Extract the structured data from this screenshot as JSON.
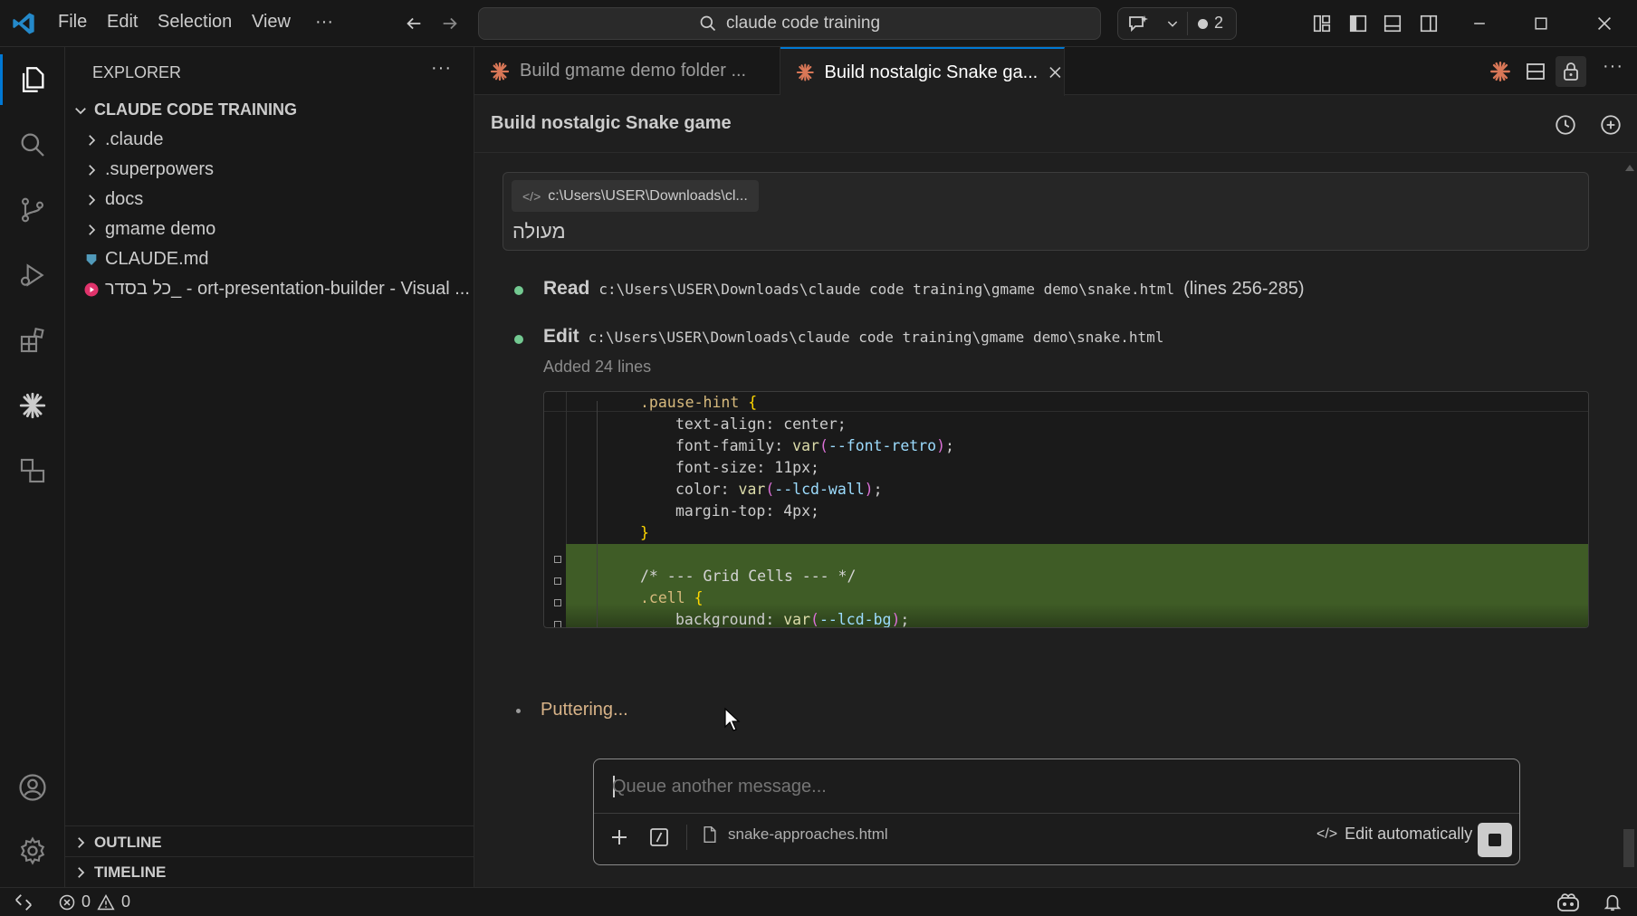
{
  "titlebar": {
    "menu": [
      "File",
      "Edit",
      "Selection",
      "View"
    ],
    "more_label": "···",
    "search_text": "claude code training",
    "chat_badge_count": "2"
  },
  "activitybar": {
    "icons": [
      "explorer-icon",
      "search-icon",
      "source-control-icon",
      "run-debug-icon",
      "extensions-icon",
      "claude-icon",
      "remote-explorer-icon",
      "account-icon",
      "settings-icon"
    ]
  },
  "sidebar": {
    "title": "EXPLORER",
    "more_label": "···",
    "root_folder": "CLAUDE CODE TRAINING",
    "items": [
      {
        "label": ".claude",
        "type": "folder"
      },
      {
        "label": ".superpowers",
        "type": "folder"
      },
      {
        "label": "docs",
        "type": "folder"
      },
      {
        "label": "gmame demo",
        "type": "folder"
      },
      {
        "label": "CLAUDE.md",
        "type": "file"
      },
      {
        "label": "כל בסדר_ - ort-presentation-builder - Visual ...",
        "type": "file"
      }
    ],
    "outline_label": "OUTLINE",
    "timeline_label": "TIMELINE"
  },
  "tabs": [
    {
      "label": "Build gmame demo folder ...",
      "active": false
    },
    {
      "label": "Build nostalgic Snake ga...",
      "active": true
    }
  ],
  "chat": {
    "title": "Build nostalgic Snake game",
    "context_chip": "c:\\Users\\USER\\Downloads\\cl...",
    "user_message": "מעולה",
    "steps": [
      {
        "verb": "Read",
        "path": "c:\\Users\\USER\\Downloads\\claude code training\\gmame demo\\snake.html",
        "suffix": "(lines 256-285)"
      },
      {
        "verb": "Edit",
        "path": "c:\\Users\\USER\\Downloads\\claude code training\\gmame demo\\snake.html",
        "suffix": ""
      }
    ],
    "edit_summary": "Added 24 lines",
    "code": {
      "l1": ".pause-hint",
      "l2_prop": "text-align: center;",
      "l3_prop": "font-family: ",
      "l3_fn": "var",
      "l3_var": "--font-retro",
      "l4_prop": "font-size: 11px;",
      "l5_prop": "color: ",
      "l5_fn": "var",
      "l5_var": "--lcd-wall",
      "l6_prop": "margin-top: 4px;",
      "l8_cmt": "/* --- Grid Cells --- */",
      "l9": ".cell",
      "l10_prop": "background: ",
      "l10_fn": "var",
      "l10_var": "--lcd-bg",
      "brace_open": "{",
      "brace_close": "}",
      "paren_open": "(",
      "paren_close": ")",
      "semi": ";"
    },
    "status_text": "Puttering...",
    "input_placeholder": "Queue another message...",
    "attached_file": "snake-approaches.html",
    "mode_label": "Edit automatically"
  },
  "statusbar": {
    "errors": "0",
    "warnings": "0"
  },
  "colors": {
    "accent": "#0078d4",
    "claude_orange": "#d97757",
    "added_bg": "#3f5c26",
    "step_dot": "#73c991"
  }
}
